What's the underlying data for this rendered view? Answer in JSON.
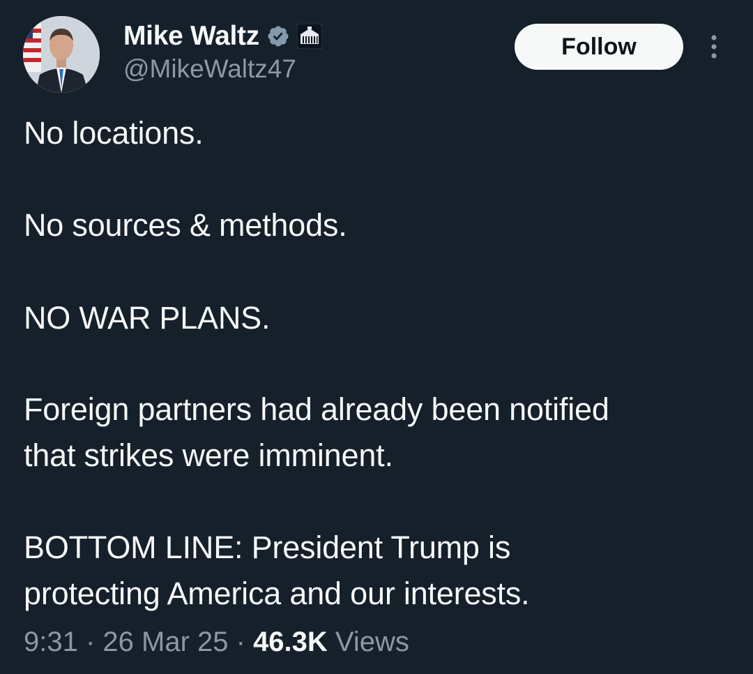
{
  "author": {
    "display_name": "Mike Waltz",
    "handle": "@MikeWaltz47",
    "verified_color": "#829aab"
  },
  "actions": {
    "follow_label": "Follow"
  },
  "tweet": {
    "paragraphs": [
      "No locations.",
      "No sources & methods.",
      "NO WAR PLANS.",
      "Foreign partners had already been notified\nthat strikes were imminent.",
      "BOTTOM LINE:  President Trump is\nprotecting America and our interests."
    ]
  },
  "meta": {
    "time": "9:31",
    "separator": " · ",
    "date": "26 Mar 25",
    "views_count": "46.3K",
    "views_label": " Views"
  },
  "colors": {
    "background": "#15202b",
    "text": "#f7f9f9",
    "muted": "#8b98a5"
  }
}
